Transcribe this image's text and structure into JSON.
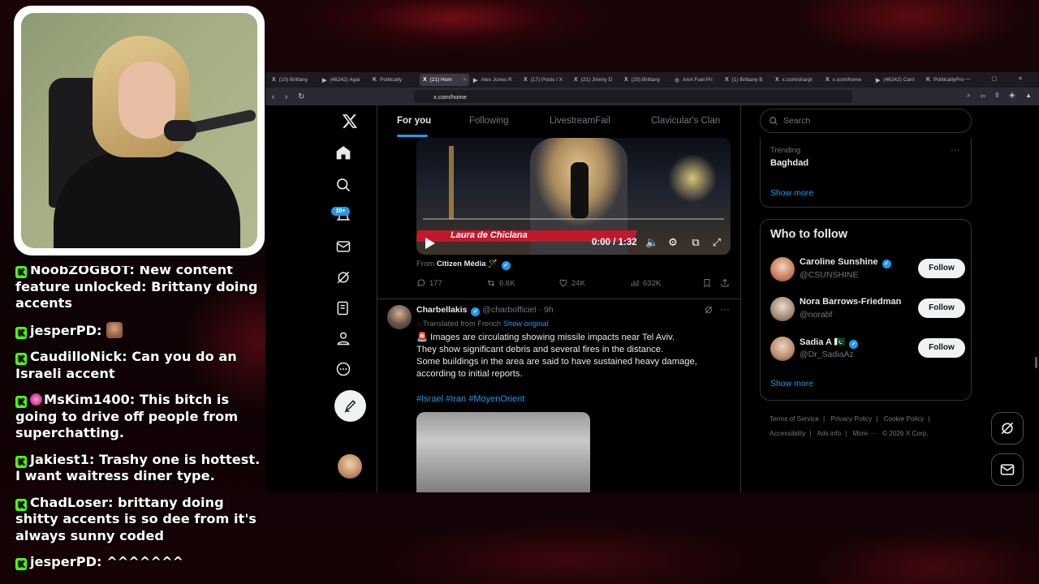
{
  "browser": {
    "tabs": [
      {
        "icon": "X",
        "label": "(10) Brittany"
      },
      {
        "icon": "▶",
        "label": "(46242) Agai"
      },
      {
        "icon": "K",
        "label": "Politically"
      },
      {
        "icon": "X",
        "label": "(21) Hom"
      },
      {
        "icon": "▶",
        "label": "Alex Jones R"
      },
      {
        "icon": "X",
        "label": "(17) Posts / X"
      },
      {
        "icon": "X",
        "label": "(21) Jimmy D"
      },
      {
        "icon": "X",
        "label": "(20) Brittany"
      },
      {
        "icon": "⊙",
        "label": "AAA Fuel Pri"
      },
      {
        "icon": "X",
        "label": "(1) Brittany B"
      },
      {
        "icon": "X",
        "label": "x.com/sharpi"
      },
      {
        "icon": "X",
        "label": "x.com/home"
      },
      {
        "icon": "▶",
        "label": "(46242) Cant"
      },
      {
        "icon": "K",
        "label": "PoliticallyPro"
      }
    ],
    "url": "x.com/home"
  },
  "x": {
    "tabs": [
      "For you",
      "Following",
      "LivestreamFail",
      "Clavicular's Clan"
    ],
    "notification_count": "20+",
    "search_placeholder": "Search",
    "video": {
      "lower_third": "Laura de Chiclana",
      "time": "0:00 / 1:32"
    },
    "post1": {
      "from_prefix": "From",
      "from_source": "Citizen Média",
      "from_emoji": "🪄",
      "replies": "177",
      "reposts": "6.6K",
      "likes": "24K",
      "views": "632K"
    },
    "post2": {
      "name": "Charbellakis",
      "handle": "@charbofficiel · 9h",
      "translated": "Translated from French",
      "show_original": "Show original",
      "body_lines": [
        "🚨 Images are circulating showing missile impacts near Tel Aviv.",
        "They show significant debris and several fires in the distance.",
        "Some buildings in the area are said to have sustained heavy damage,",
        "according to initial reports."
      ],
      "hashtags": "#Israel #Iran #MoyenOrient"
    },
    "trending": {
      "category": "Trending",
      "topic": "Baghdad",
      "show_more": "Show more"
    },
    "who_to_follow": {
      "title": "Who to follow",
      "follow_label": "Follow",
      "show_more": "Show more",
      "accounts": [
        {
          "name": "Caroline Sunshine",
          "handle": "@CSUNSHINE"
        },
        {
          "name": "Nora Barrows-Friedman",
          "handle": "@norabf"
        },
        {
          "name": "Sadia A 🇵🇰",
          "handle": "@Dr_SadiaAz"
        }
      ]
    },
    "footer": {
      "line1": [
        "Terms of Service",
        "|",
        "Privacy Policy",
        "|",
        "Cookie Policy",
        "|"
      ],
      "line2": [
        "Accessibility",
        "|",
        "Ads info",
        "|",
        "More ···",
        "© 2026 X Corp."
      ]
    }
  },
  "chat": [
    {
      "user": "NoobZOGBOT",
      "text": ": New content feature unlocked: Brittany doing accents"
    },
    {
      "user": "jesperPD",
      "text": ": ",
      "emote": true
    },
    {
      "user": "CaudilloNick",
      "text": ": Can you do an Israeli accent"
    },
    {
      "user": "MsKim1400",
      "text": ": This bitch is going to drive off people from superchatting.",
      "sub": true
    },
    {
      "user": "Jakiest1",
      "text": ": Trashy one is hottest. I want waitress diner type."
    },
    {
      "user": "ChadLoser",
      "text": ": brittany doing shitty accents is so dee from it's always sunny coded"
    },
    {
      "user": "jesperPD",
      "text": ": ^^^^^^^"
    }
  ]
}
